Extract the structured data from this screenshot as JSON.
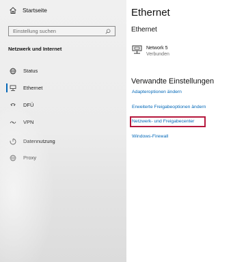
{
  "sidebar": {
    "home_label": "Startseite",
    "search_placeholder": "Einstellung suchen",
    "section_title": "Netzwerk und Internet",
    "items": [
      {
        "label": "Status",
        "icon": "globe-icon"
      },
      {
        "label": "Ethernet",
        "icon": "ethernet-icon",
        "active": true
      },
      {
        "label": "DFÜ",
        "icon": "dialup-icon"
      },
      {
        "label": "VPN",
        "icon": "vpn-icon"
      },
      {
        "label": "Datennutzung",
        "icon": "data-usage-icon"
      },
      {
        "label": "Proxy",
        "icon": "proxy-globe-icon"
      }
    ]
  },
  "main": {
    "title": "Ethernet",
    "subtitle": "Ethernet",
    "network": {
      "name": "Network 5",
      "status": "Verbunden"
    },
    "related_title": "Verwandte Einstellungen",
    "links": [
      "Adapteroptionen ändern",
      "Erweiterte Freigabeoptionen ändern",
      "Netzwerk- und Freigabecenter",
      "Windows-Firewall"
    ]
  },
  "colors": {
    "accent": "#0067b8",
    "highlight": "#b5173c",
    "sidebar_bg": "#ececec"
  }
}
